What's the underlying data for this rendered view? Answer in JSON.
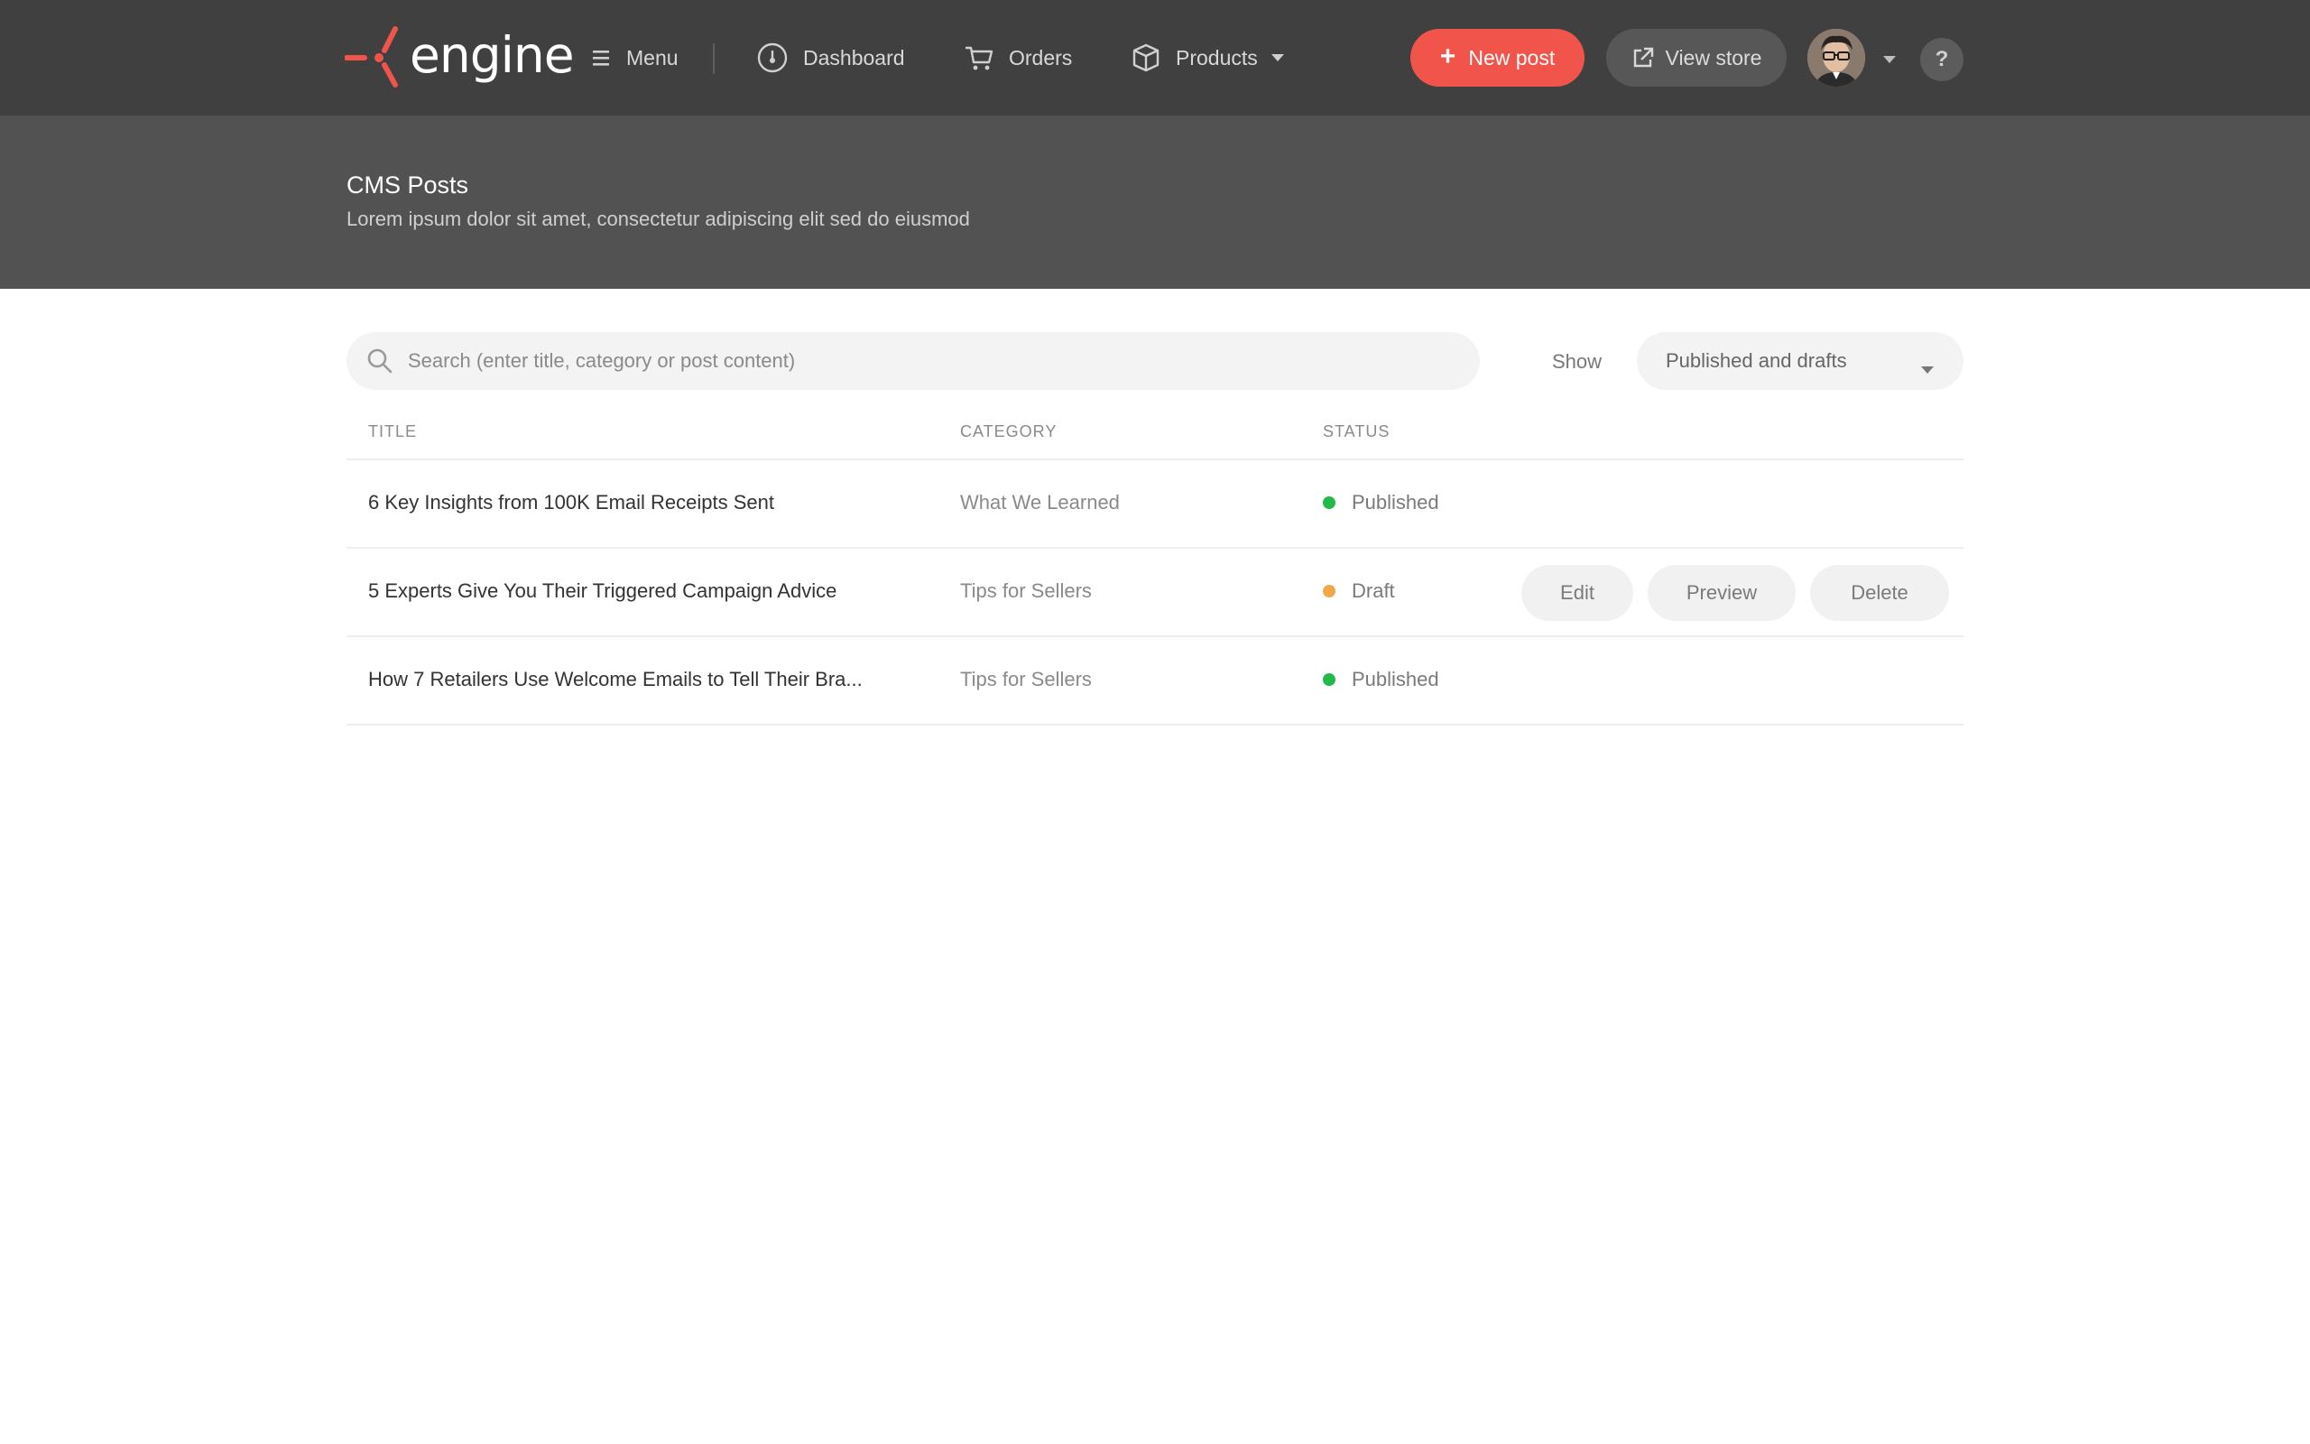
{
  "brand": {
    "name": "engine",
    "accent_color": "#f0544a"
  },
  "nav": {
    "menu_label": "Menu",
    "items": [
      {
        "label": "Dashboard",
        "icon": "dashboard-gauge-icon"
      },
      {
        "label": "Orders",
        "icon": "cart-icon"
      },
      {
        "label": "Products",
        "icon": "box-icon"
      }
    ],
    "new_post_label": "New post",
    "view_store_label": "View store",
    "help_label": "?"
  },
  "header": {
    "title": "CMS Posts",
    "subtitle": "Lorem ipsum dolor sit amet, consectetur adipiscing elit sed do eiusmod"
  },
  "filters": {
    "search_placeholder": "Search (enter title, category or post content)",
    "search_value": "",
    "show_label": "Show",
    "show_selected": "Published and drafts"
  },
  "table": {
    "columns": [
      "TITLE",
      "CATEGORY",
      "STATUS"
    ],
    "rows": [
      {
        "title": "6 Key Insights from 100K Email Receipts Sent",
        "category": "What We Learned",
        "status": "Published",
        "status_color": "#22b84a"
      },
      {
        "title": "5 Experts Give You Their Triggered Campaign Advice",
        "category": "Tips for Sellers",
        "status": "Draft",
        "status_color": "#f0a94a"
      },
      {
        "title": "How 7 Retailers Use Welcome Emails to Tell Their Bra...",
        "category": "Tips for Sellers",
        "status": "Published",
        "status_color": "#22b84a"
      }
    ],
    "row_actions": [
      "Edit",
      "Preview",
      "Delete"
    ]
  }
}
